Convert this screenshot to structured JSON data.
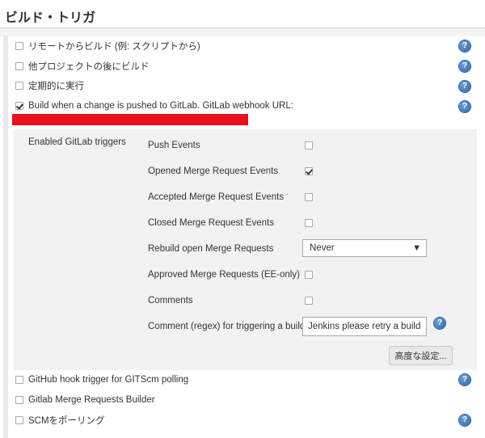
{
  "section_title": "ビルド・トリガ",
  "triggers": [
    {
      "label": "リモートからビルド (例: スクリプトから)",
      "checked": false,
      "help": true
    },
    {
      "label": "他プロジェクトの後にビルド",
      "checked": false,
      "help": true
    },
    {
      "label": "定期的に実行",
      "checked": false,
      "help": true
    },
    {
      "label": "Build when a change is pushed to GitLab. GitLab webhook URL:",
      "checked": true,
      "help": true
    },
    {
      "label": "GitHub hook trigger for GITScm polling",
      "checked": false,
      "help": true
    },
    {
      "label": "Gitlab Merge Requests Builder",
      "checked": false,
      "help": false
    },
    {
      "label": "SCMをポーリング",
      "checked": false,
      "help": true
    }
  ],
  "gitlab": {
    "section_label": "Enabled GitLab triggers",
    "options": [
      {
        "label": "Push Events",
        "checked": false
      },
      {
        "label": "Opened Merge Request Events",
        "checked": true
      },
      {
        "label": "Accepted Merge Request Events",
        "checked": false
      },
      {
        "label": "Closed Merge Request Events",
        "checked": false
      },
      {
        "label": "Rebuild open Merge Requests"
      },
      {
        "label": "Approved Merge Requests (EE-only)",
        "checked": false
      },
      {
        "label": "Comments",
        "checked": false
      },
      {
        "label": "Comment (regex) for triggering a build"
      }
    ],
    "rebuild_select_value": "Never",
    "comment_regex_value": "Jenkins please retry a build",
    "advanced_button": "高度な設定..."
  },
  "icons": {
    "help": "question-mark-icon",
    "dropdown": "dropdown-arrow-icon"
  },
  "colors": {
    "redacted": "#e8101e",
    "help_blue": "#2f66a8",
    "panel_bg": "#f2f2f2"
  }
}
